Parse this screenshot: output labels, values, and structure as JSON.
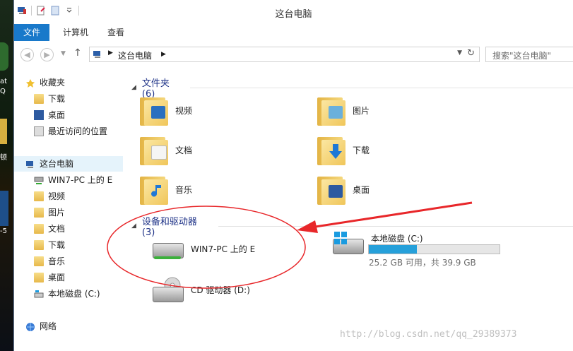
{
  "desktop": {
    "text_1": "at",
    "text_2": "Q",
    "text_3": "顿",
    "text_4": "-5"
  },
  "window": {
    "title": "这台电脑"
  },
  "ribbon": {
    "tabs": [
      {
        "label": "文件"
      },
      {
        "label": "计算机"
      },
      {
        "label": "查看"
      }
    ]
  },
  "address": {
    "crumb": "这台电脑",
    "search_placeholder": "搜索\"这台电脑\""
  },
  "sidebar": {
    "favorites": {
      "label": "收藏夹",
      "items": [
        "下载",
        "桌面",
        "最近访问的位置"
      ]
    },
    "this_pc": {
      "label": "这台电脑",
      "items": [
        "WIN7-PC 上的 E",
        "视频",
        "图片",
        "文档",
        "下载",
        "音乐",
        "桌面",
        "本地磁盘 (C:)"
      ]
    },
    "network": {
      "label": "网络"
    }
  },
  "folders": {
    "header": "文件夹 (6)",
    "items": [
      "视频",
      "图片",
      "文档",
      "下载",
      "音乐",
      "桌面"
    ]
  },
  "devices": {
    "header": "设备和驱动器 (3)",
    "net_drive": "WIN7-PC 上的 E",
    "local_disk": {
      "label": "本地磁盘 (C:)",
      "used_fraction": 0.37,
      "free_text": "25.2 GB 可用，共 39.9 GB"
    },
    "cd_drive": "CD 驱动器 (D:)"
  },
  "watermark": "http://blog.csdn.net/qq_29389373",
  "colors": {
    "accent": "#1979ca",
    "annotation": "#e8272a",
    "disk_fill": "#26a0da"
  }
}
